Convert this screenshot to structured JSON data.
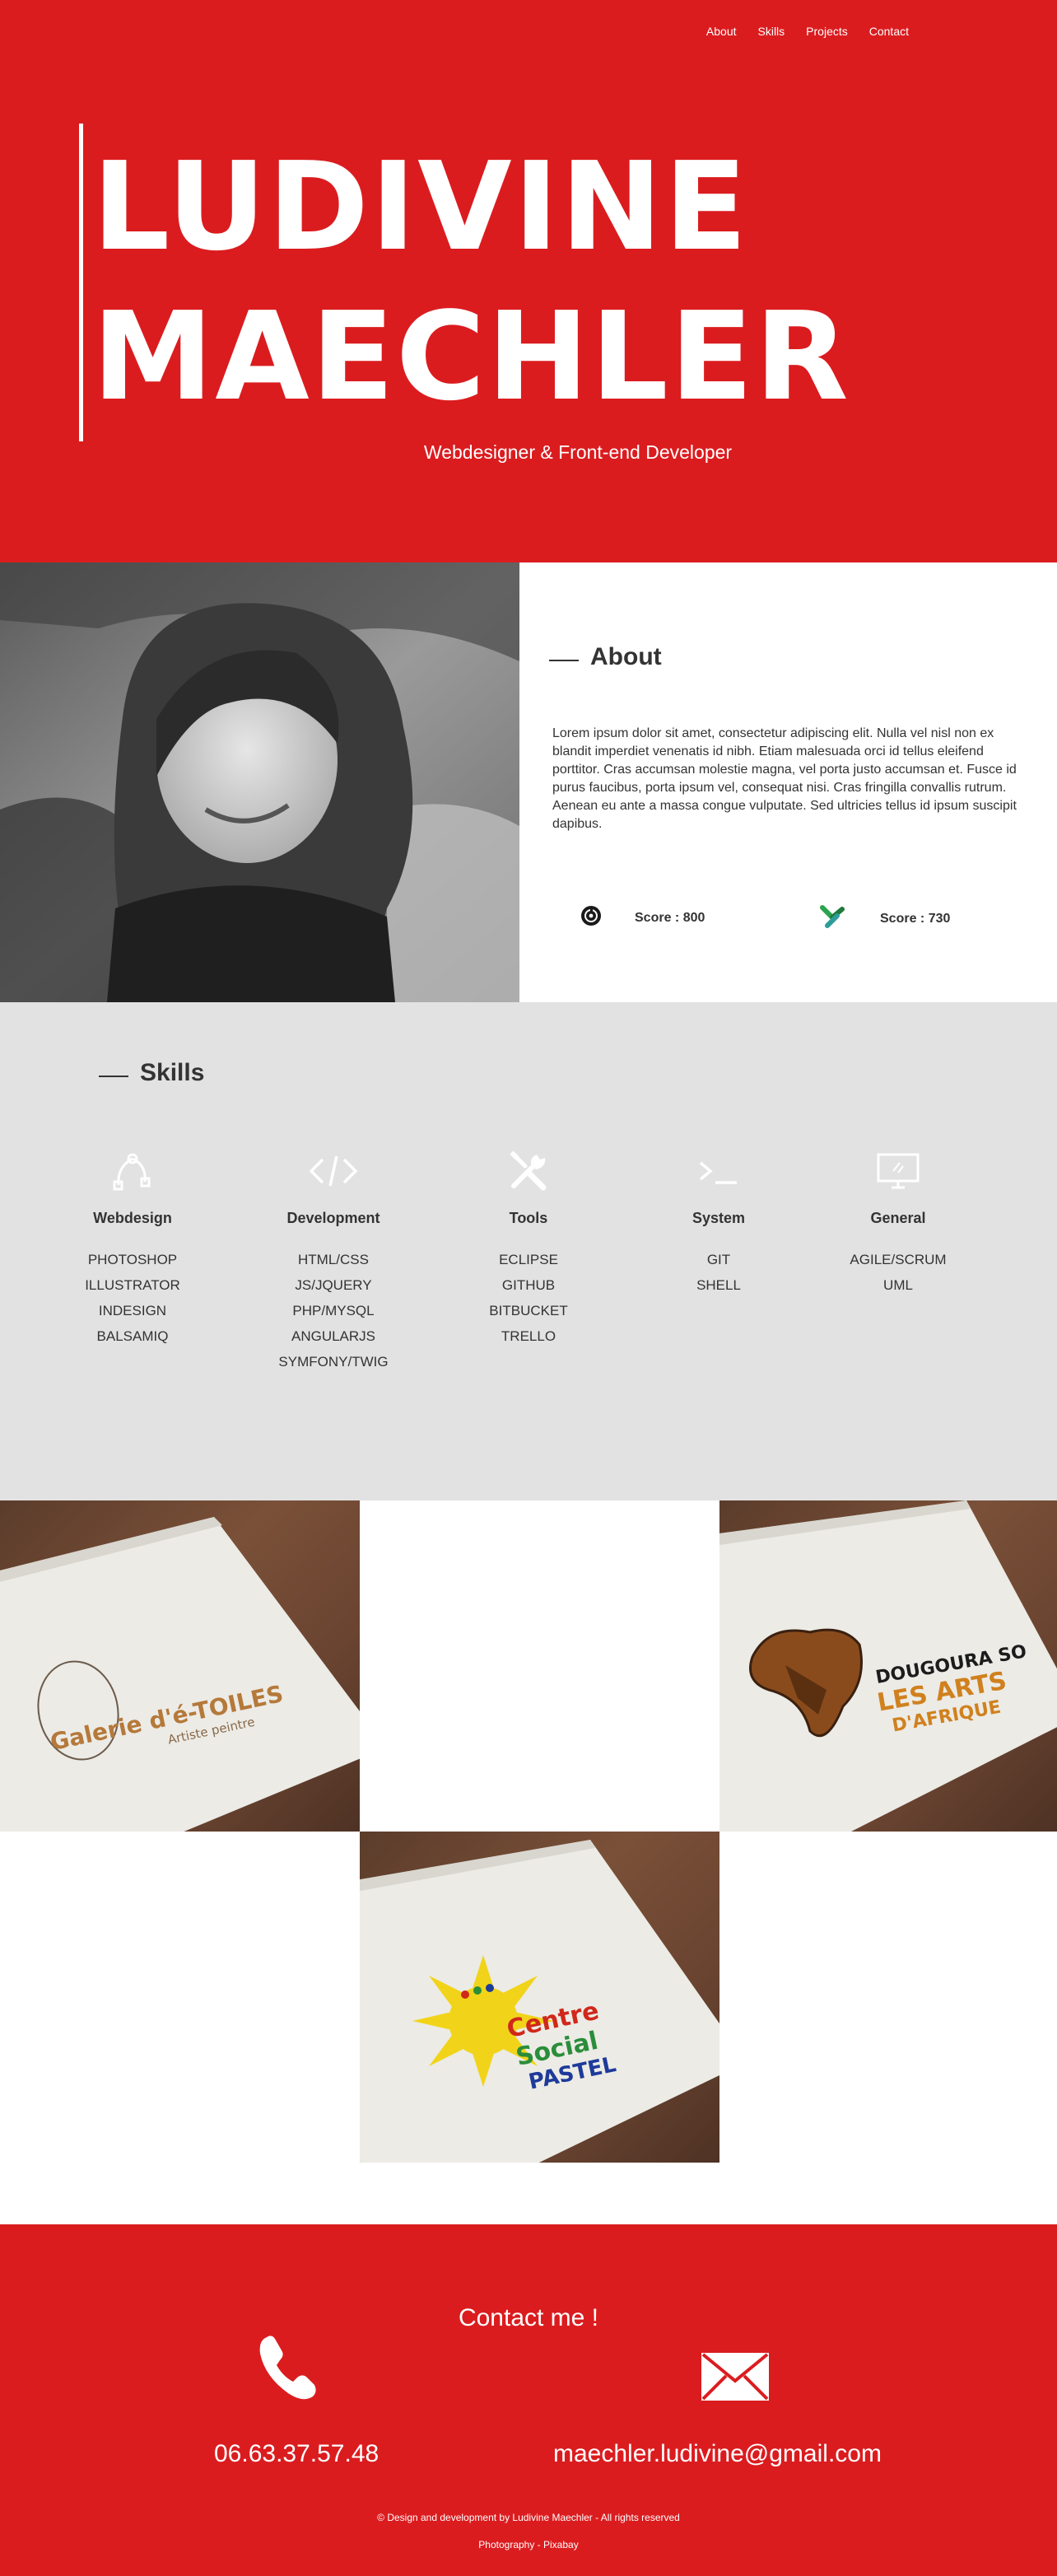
{
  "nav": {
    "items": [
      "About",
      "Skills",
      "Projects",
      "Contact"
    ]
  },
  "hero": {
    "first_name": "LUDIVINE",
    "last_name": "MAECHLER",
    "subtitle": "Webdesigner & Front-end Developer"
  },
  "about": {
    "title": "About",
    "paragraph": "Lorem ipsum dolor sit amet, consectetur adipiscing elit. Nulla vel nisl non ex blandit imperdiet venenatis id nibh. Etiam malesuada orci id tellus eleifend porttitor. Cras accumsan molestie magna, vel porta justo accumsan et. Fusce id purus faucibus, porta ipsum vel, consequat nisi. Cras fringilla convallis rutrum. Aenean eu ante a massa congue vulputate. Sed ultricies tellus id ipsum suscipit dapibus.",
    "scores": [
      {
        "label": "Score : 800",
        "icon": "codingame-icon"
      },
      {
        "label": "Score : 730",
        "icon": "codewars-icon"
      }
    ]
  },
  "skills": {
    "title": "Skills",
    "columns": [
      {
        "name": "Webdesign",
        "icon": "pen-tool-icon",
        "items": [
          "PHOTOSHOP",
          "ILLUSTRATOR",
          "INDESIGN",
          "BALSAMIQ"
        ]
      },
      {
        "name": "Development",
        "icon": "code-icon",
        "items": [
          "HTML/CSS",
          "JS/JQUERY",
          "PHP/MYSQL",
          "ANGULARJS",
          "SYMFONY/TWIG"
        ]
      },
      {
        "name": "Tools",
        "icon": "tools-icon",
        "items": [
          "ECLIPSE",
          "GITHUB",
          "BITBUCKET",
          "TRELLO"
        ]
      },
      {
        "name": "System",
        "icon": "terminal-icon",
        "items": [
          "GIT",
          "SHELL"
        ]
      },
      {
        "name": "General",
        "icon": "monitor-icon",
        "items": [
          "AGILE/SCRUM",
          "UML"
        ]
      }
    ]
  },
  "projects": [
    {
      "logo_line1": "Galerie d'é-TOILES",
      "logo_line2": "Artiste peintre"
    },
    {
      "logo_line1": "DOUGOURA SO",
      "logo_line2": "LES ARTS",
      "logo_line3": "D'AFRIQUE"
    },
    {
      "logo_line1": "Centre",
      "logo_line2": "Social",
      "logo_line3": "PASTEL"
    }
  ],
  "contact": {
    "title": "Contact me !",
    "phone": "06.63.37.57.48",
    "email": "maechler.ludivine@gmail.com",
    "footer_line1": "© Design and development by Ludivine Maechler - All rights reserved",
    "footer_line2": "Photography - Pixabay"
  },
  "colors": {
    "brand_red": "#db1c1f",
    "skills_bg": "#e2e2e2"
  }
}
